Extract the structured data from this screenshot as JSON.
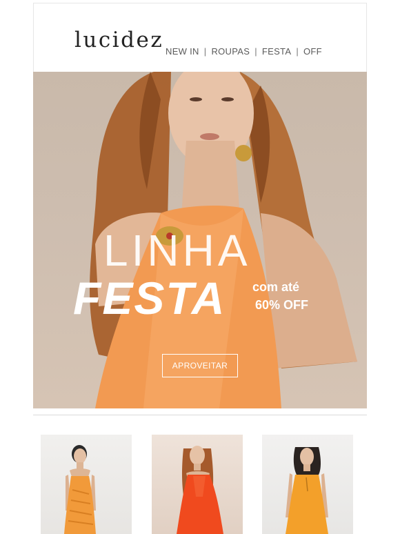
{
  "header": {
    "logo": "lucidez",
    "nav": [
      "NEW IN",
      "ROUPAS",
      "FESTA",
      "OFF"
    ],
    "separator": "|"
  },
  "hero": {
    "title_line1": "LINHA",
    "title_line2": "FESTA",
    "subtitle_line1": "com até",
    "subtitle_line2": "60% OFF",
    "cta_label": "APROVEITAR",
    "image": "woman-orange-halter-dress"
  },
  "products": [
    {
      "image": "model-orange-ruched-dress"
    },
    {
      "image": "model-red-orange-dress"
    },
    {
      "image": "model-orange-slip-dress"
    }
  ],
  "colors": {
    "accent_orange": "#f29a52",
    "text": "#222222"
  }
}
